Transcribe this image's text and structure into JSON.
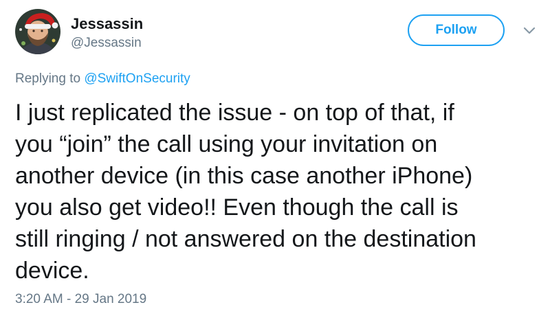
{
  "author": {
    "display_name": "Jessassin",
    "handle": "@Jessassin",
    "avatar_icon": "profile-photo-santa-hat"
  },
  "follow_button": {
    "label": "Follow",
    "color": "#1da1f2"
  },
  "menu_icon": "chevron-down-icon",
  "reply": {
    "prefix": "Replying to ",
    "to_handle": "@SwiftOnSecurity"
  },
  "tweet": {
    "lines": [
      "I just replicated the issue - on top of that, if",
      "you “join” the call using your invitation on",
      "another device (in this case another iPhone)",
      "you also get video!! Even though the call is",
      "still ringing / not answered on the destination",
      "device."
    ],
    "timestamp": "3:20 AM - 29 Jan 2019"
  },
  "colors": {
    "text": "#14171a",
    "secondary": "#657786",
    "accent": "#1da1f2"
  }
}
